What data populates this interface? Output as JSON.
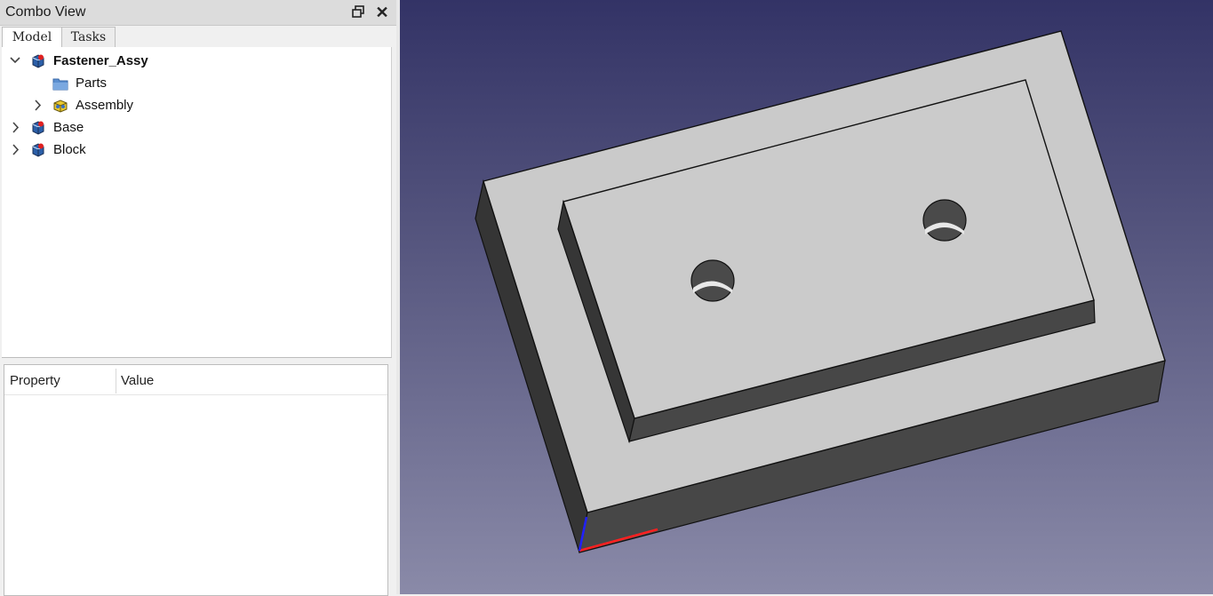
{
  "combo": {
    "title": "Combo View",
    "undock_icon": "undock-icon",
    "close_icon": "close-icon",
    "tabs": [
      {
        "label": "Model",
        "active": true
      },
      {
        "label": "Tasks",
        "active": false
      }
    ]
  },
  "tree": {
    "items": [
      {
        "label": "Fastener_Assy",
        "bold": true,
        "expanded": true,
        "icon": "part-icon"
      },
      {
        "label": "Parts",
        "icon": "folder-icon"
      },
      {
        "label": "Assembly",
        "expanded": false,
        "icon": "assembly-icon"
      },
      {
        "label": "Base",
        "expanded": false,
        "icon": "part-icon"
      },
      {
        "label": "Block",
        "expanded": false,
        "icon": "part-icon"
      }
    ]
  },
  "properties": {
    "col_property": "Property",
    "col_value": "Value"
  },
  "view3d": {
    "background_top": "#333366",
    "background_bottom": "#8a8aa8",
    "model_face": "#cccccc",
    "model_side_dark": "#3a3a3a",
    "axis_x_color": "#ff2020",
    "axis_z_color": "#2020ff"
  }
}
